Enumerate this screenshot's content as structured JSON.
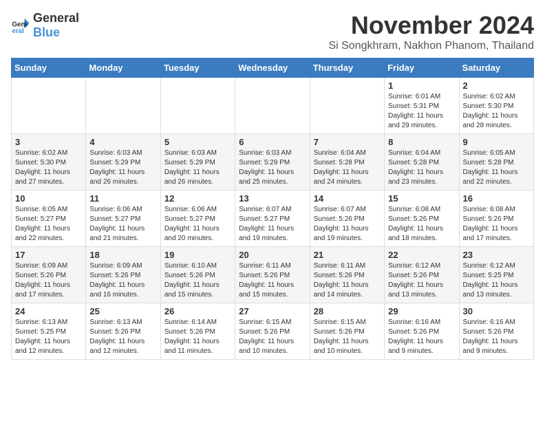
{
  "header": {
    "logo_general": "General",
    "logo_blue": "Blue",
    "month": "November 2024",
    "location": "Si Songkhram, Nakhon Phanom, Thailand"
  },
  "weekdays": [
    "Sunday",
    "Monday",
    "Tuesday",
    "Wednesday",
    "Thursday",
    "Friday",
    "Saturday"
  ],
  "weeks": [
    [
      {
        "day": "",
        "info": ""
      },
      {
        "day": "",
        "info": ""
      },
      {
        "day": "",
        "info": ""
      },
      {
        "day": "",
        "info": ""
      },
      {
        "day": "",
        "info": ""
      },
      {
        "day": "1",
        "info": "Sunrise: 6:01 AM\nSunset: 5:31 PM\nDaylight: 11 hours and 29 minutes."
      },
      {
        "day": "2",
        "info": "Sunrise: 6:02 AM\nSunset: 5:30 PM\nDaylight: 11 hours and 28 minutes."
      }
    ],
    [
      {
        "day": "3",
        "info": "Sunrise: 6:02 AM\nSunset: 5:30 PM\nDaylight: 11 hours and 27 minutes."
      },
      {
        "day": "4",
        "info": "Sunrise: 6:03 AM\nSunset: 5:29 PM\nDaylight: 11 hours and 26 minutes."
      },
      {
        "day": "5",
        "info": "Sunrise: 6:03 AM\nSunset: 5:29 PM\nDaylight: 11 hours and 26 minutes."
      },
      {
        "day": "6",
        "info": "Sunrise: 6:03 AM\nSunset: 5:29 PM\nDaylight: 11 hours and 25 minutes."
      },
      {
        "day": "7",
        "info": "Sunrise: 6:04 AM\nSunset: 5:28 PM\nDaylight: 11 hours and 24 minutes."
      },
      {
        "day": "8",
        "info": "Sunrise: 6:04 AM\nSunset: 5:28 PM\nDaylight: 11 hours and 23 minutes."
      },
      {
        "day": "9",
        "info": "Sunrise: 6:05 AM\nSunset: 5:28 PM\nDaylight: 11 hours and 22 minutes."
      }
    ],
    [
      {
        "day": "10",
        "info": "Sunrise: 6:05 AM\nSunset: 5:27 PM\nDaylight: 11 hours and 22 minutes."
      },
      {
        "day": "11",
        "info": "Sunrise: 6:06 AM\nSunset: 5:27 PM\nDaylight: 11 hours and 21 minutes."
      },
      {
        "day": "12",
        "info": "Sunrise: 6:06 AM\nSunset: 5:27 PM\nDaylight: 11 hours and 20 minutes."
      },
      {
        "day": "13",
        "info": "Sunrise: 6:07 AM\nSunset: 5:27 PM\nDaylight: 11 hours and 19 minutes."
      },
      {
        "day": "14",
        "info": "Sunrise: 6:07 AM\nSunset: 5:26 PM\nDaylight: 11 hours and 19 minutes."
      },
      {
        "day": "15",
        "info": "Sunrise: 6:08 AM\nSunset: 5:26 PM\nDaylight: 11 hours and 18 minutes."
      },
      {
        "day": "16",
        "info": "Sunrise: 6:08 AM\nSunset: 5:26 PM\nDaylight: 11 hours and 17 minutes."
      }
    ],
    [
      {
        "day": "17",
        "info": "Sunrise: 6:09 AM\nSunset: 5:26 PM\nDaylight: 11 hours and 17 minutes."
      },
      {
        "day": "18",
        "info": "Sunrise: 6:09 AM\nSunset: 5:26 PM\nDaylight: 11 hours and 16 minutes."
      },
      {
        "day": "19",
        "info": "Sunrise: 6:10 AM\nSunset: 5:26 PM\nDaylight: 11 hours and 15 minutes."
      },
      {
        "day": "20",
        "info": "Sunrise: 6:11 AM\nSunset: 5:26 PM\nDaylight: 11 hours and 15 minutes."
      },
      {
        "day": "21",
        "info": "Sunrise: 6:11 AM\nSunset: 5:26 PM\nDaylight: 11 hours and 14 minutes."
      },
      {
        "day": "22",
        "info": "Sunrise: 6:12 AM\nSunset: 5:26 PM\nDaylight: 11 hours and 13 minutes."
      },
      {
        "day": "23",
        "info": "Sunrise: 6:12 AM\nSunset: 5:25 PM\nDaylight: 11 hours and 13 minutes."
      }
    ],
    [
      {
        "day": "24",
        "info": "Sunrise: 6:13 AM\nSunset: 5:25 PM\nDaylight: 11 hours and 12 minutes."
      },
      {
        "day": "25",
        "info": "Sunrise: 6:13 AM\nSunset: 5:26 PM\nDaylight: 11 hours and 12 minutes."
      },
      {
        "day": "26",
        "info": "Sunrise: 6:14 AM\nSunset: 5:26 PM\nDaylight: 11 hours and 11 minutes."
      },
      {
        "day": "27",
        "info": "Sunrise: 6:15 AM\nSunset: 5:26 PM\nDaylight: 11 hours and 10 minutes."
      },
      {
        "day": "28",
        "info": "Sunrise: 6:15 AM\nSunset: 5:26 PM\nDaylight: 11 hours and 10 minutes."
      },
      {
        "day": "29",
        "info": "Sunrise: 6:16 AM\nSunset: 5:26 PM\nDaylight: 11 hours and 9 minutes."
      },
      {
        "day": "30",
        "info": "Sunrise: 6:16 AM\nSunset: 5:26 PM\nDaylight: 11 hours and 9 minutes."
      }
    ]
  ]
}
